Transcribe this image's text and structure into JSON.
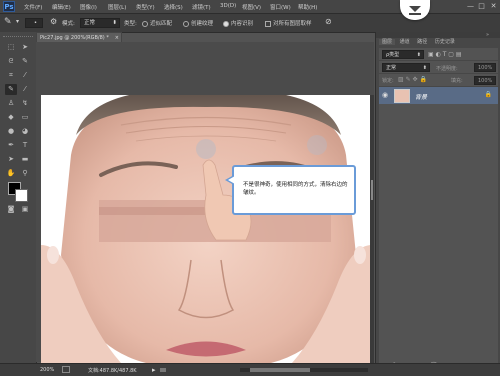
{
  "app": {
    "logo": "Ps"
  },
  "menu": [
    "文件(F)",
    "编辑(E)",
    "图像(I)",
    "图层(L)",
    "类型(Y)",
    "选择(S)",
    "滤镜(T)",
    "3D(D)",
    "视图(V)",
    "窗口(W)",
    "帮助(H)"
  ],
  "window_controls": {
    "min": "—",
    "max": "□",
    "close": "✕"
  },
  "options": {
    "mode_label": "模式:",
    "mode_value": "正常",
    "type_label": "类型:",
    "proximity_label": "近似匹配",
    "texture_label": "创建纹理",
    "content_aware_label": "内容识别",
    "sample_all_label": "对所有图层取样"
  },
  "document": {
    "tab_title": "Pic27.jpg @ 200%(RGB/8) *",
    "close": "×"
  },
  "tooltip": {
    "text": "不是很神奇，使用相同的方式，清除右边的皱纹。"
  },
  "layers_panel": {
    "tabs": [
      "图层",
      "通道",
      "路径",
      "历史记录"
    ],
    "filter_label": "ρ类型",
    "blend_mode": "正常",
    "opacity_label": "不透明度:",
    "opacity_value": "100%",
    "lock_label": "锁定:",
    "fill_label": "填充:",
    "fill_value": "100%",
    "layers": [
      {
        "name": "背景",
        "visible": true,
        "locked": true
      }
    ]
  },
  "status": {
    "zoom": "200%",
    "doc_size": "文档:487.8K/487.8K"
  },
  "colors": {
    "accent": "#6a9bd8",
    "ui_dark": "#474747",
    "layer_selected": "#596b86"
  }
}
